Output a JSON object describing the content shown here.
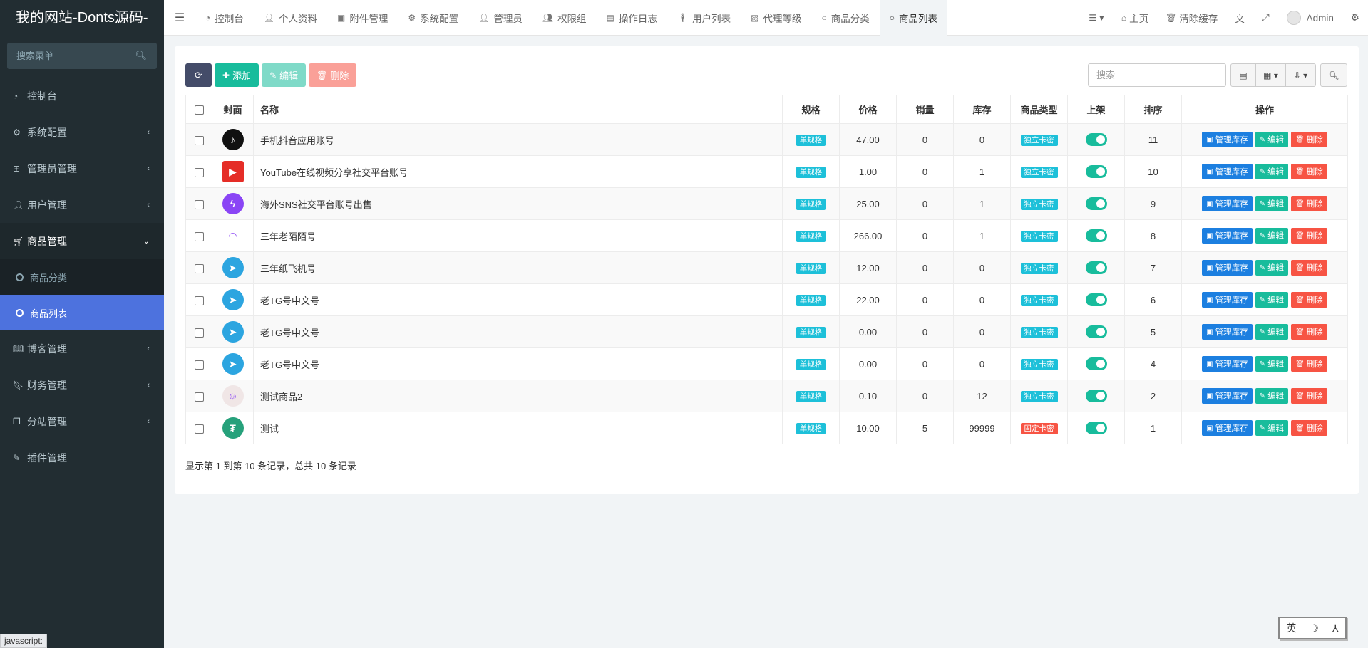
{
  "sidebar": {
    "logo": "我的网站-Donts源码-",
    "search_placeholder": "搜索菜单",
    "menu": [
      {
        "label": "控制台",
        "icon": "dashboard-icon",
        "has_children": false
      },
      {
        "label": "系统配置",
        "icon": "cogs-icon",
        "has_children": true
      },
      {
        "label": "管理员管理",
        "icon": "windows-icon",
        "has_children": true
      },
      {
        "label": "用户管理",
        "icon": "user-icon",
        "has_children": true
      },
      {
        "label": "商品管理",
        "icon": "cart-icon",
        "has_children": true,
        "open": true
      }
    ],
    "submenu": [
      {
        "label": "商品分类",
        "active": false
      },
      {
        "label": "商品列表",
        "active": true
      }
    ],
    "menu2": [
      {
        "label": "博客管理",
        "icon": "book-icon"
      },
      {
        "label": "财务管理",
        "icon": "bookmark-icon"
      },
      {
        "label": "分站管理",
        "icon": "clone-icon"
      }
    ],
    "plugin_label": "插件管理",
    "status_url": "javascript:"
  },
  "topbar": {
    "tabs": [
      {
        "label": "控制台",
        "icon": "dashboard-icon"
      },
      {
        "label": "个人资料",
        "icon": "user-icon"
      },
      {
        "label": "附件管理",
        "icon": "file-image-icon"
      },
      {
        "label": "系统配置",
        "icon": "cog-icon"
      },
      {
        "label": "管理员",
        "icon": "user-icon"
      },
      {
        "label": "权限组",
        "icon": "group-icon"
      },
      {
        "label": "操作日志",
        "icon": "list-alt-icon"
      },
      {
        "label": "用户列表",
        "icon": "male-icon"
      },
      {
        "label": "代理等级",
        "icon": "picture-icon"
      },
      {
        "label": "商品分类",
        "icon": "circle-icon"
      },
      {
        "label": "商品列表",
        "icon": "circle-icon",
        "active": true
      }
    ],
    "home_label": "主页",
    "clear_cache_label": "清除缓存",
    "admin_name": "Admin"
  },
  "toolbar": {
    "add_label": "添加",
    "edit_label": "编辑",
    "delete_label": "删除",
    "search_placeholder": "搜索"
  },
  "table": {
    "headers": {
      "cover": "封面",
      "name": "名称",
      "spec": "规格",
      "price": "价格",
      "sales": "销量",
      "stock": "库存",
      "type": "商品类型",
      "status": "上架",
      "sort": "排序",
      "ops": "操作"
    },
    "op_stock_label": "管理库存",
    "op_edit_label": "编辑",
    "op_delete_label": "删除",
    "rows": [
      {
        "cover": "tiktok-logo",
        "cover_color": "#111111",
        "cover_glyph": "♪",
        "name": "手机抖音应用账号",
        "spec": "单规格",
        "price": "47.00",
        "sales": "0",
        "stock": "0",
        "type": "独立卡密",
        "type_kind": "info",
        "sort": "11"
      },
      {
        "cover": "youtube-logo",
        "cover_color": "#e52d27",
        "cover_glyph": "▶",
        "name": "YouTube在线视频分享社交平台账号",
        "spec": "单规格",
        "price": "1.00",
        "sales": "0",
        "stock": "1",
        "type": "独立卡密",
        "type_kind": "info",
        "sort": "10"
      },
      {
        "cover": "messenger-logo",
        "cover_color": "#8a45f5",
        "cover_glyph": "ϟ",
        "name": "海外SNS社交平台账号出售",
        "spec": "单规格",
        "price": "25.00",
        "sales": "0",
        "stock": "1",
        "type": "独立卡密",
        "type_kind": "info",
        "sort": "9"
      },
      {
        "cover": "momo-logo",
        "cover_color": "#ffffff",
        "cover_glyph": "◠",
        "name": "三年老陌陌号",
        "spec": "单规格",
        "price": "266.00",
        "sales": "0",
        "stock": "1",
        "type": "独立卡密",
        "type_kind": "info",
        "sort": "8"
      },
      {
        "cover": "telegram-logo",
        "cover_color": "#2ca5e0",
        "cover_glyph": "➤",
        "name": "三年纸飞机号",
        "spec": "单规格",
        "price": "12.00",
        "sales": "0",
        "stock": "0",
        "type": "独立卡密",
        "type_kind": "info",
        "sort": "7"
      },
      {
        "cover": "telegram-logo",
        "cover_color": "#2ca5e0",
        "cover_glyph": "➤",
        "name": "老TG号中文号",
        "spec": "单规格",
        "price": "22.00",
        "sales": "0",
        "stock": "0",
        "type": "独立卡密",
        "type_kind": "info",
        "sort": "6"
      },
      {
        "cover": "telegram-logo",
        "cover_color": "#2ca5e0",
        "cover_glyph": "➤",
        "name": "老TG号中文号",
        "spec": "单规格",
        "price": "0.00",
        "sales": "0",
        "stock": "0",
        "type": "独立卡密",
        "type_kind": "info",
        "sort": "5"
      },
      {
        "cover": "telegram-logo",
        "cover_color": "#2ca5e0",
        "cover_glyph": "➤",
        "name": "老TG号中文号",
        "spec": "单规格",
        "price": "0.00",
        "sales": "0",
        "stock": "0",
        "type": "独立卡密",
        "type_kind": "info",
        "sort": "4"
      },
      {
        "cover": "anime-avatar",
        "cover_color": "#f0e6e6",
        "cover_glyph": "☺",
        "name": "测试商品2",
        "spec": "单规格",
        "price": "0.10",
        "sales": "0",
        "stock": "12",
        "type": "独立卡密",
        "type_kind": "info",
        "sort": "2"
      },
      {
        "cover": "tether-logo",
        "cover_color": "#26a17b",
        "cover_glyph": "₮",
        "name": "测试",
        "spec": "单规格",
        "price": "10.00",
        "sales": "5",
        "stock": "99999",
        "type": "固定卡密",
        "type_kind": "danger",
        "sort": "1"
      }
    ]
  },
  "summary": "显示第 1 到第 10 条记录，总共 10 条记录",
  "ime": {
    "lang": "英",
    "moon": "☽",
    "punct": "⅄"
  },
  "colors": {
    "accent": "#4d72de",
    "success": "#18bc9c",
    "danger": "#f75444",
    "primary": "#1c7fe0",
    "sidebar": "#222d32"
  }
}
